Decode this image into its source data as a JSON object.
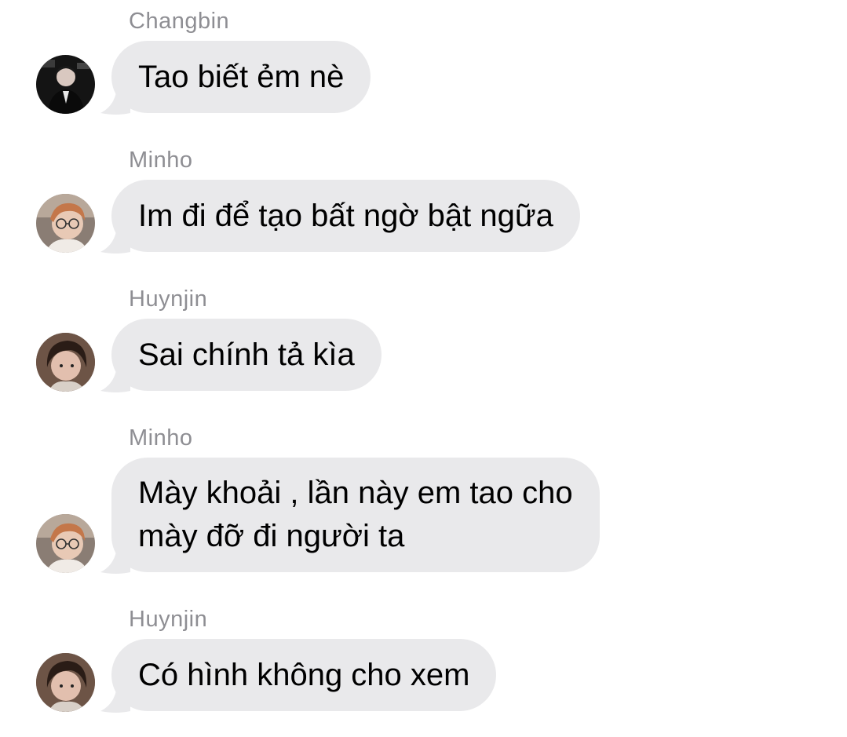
{
  "chat": {
    "colors": {
      "background": "#ffffff",
      "bubble": "#e9e9eb",
      "sender_name": "#8e8e93",
      "message_text": "#000000"
    },
    "messages": [
      {
        "sender": "Changbin",
        "text": "Tao biết ẻm nè",
        "avatar": "changbin-avatar"
      },
      {
        "sender": "Minho",
        "text": "Im đi để tạo bất ngờ bật ngữa",
        "avatar": "minho-avatar"
      },
      {
        "sender": "Huynjin",
        "text": "Sai chính tả kìa",
        "avatar": "huynjin-avatar"
      },
      {
        "sender": "Minho",
        "text": "Mày khoải , lần này em tao cho\nmày đỡ đi người ta",
        "avatar": "minho-avatar"
      },
      {
        "sender": "Huynjin",
        "text": "Có hình không cho xem",
        "avatar": "huynjin-avatar"
      }
    ]
  }
}
